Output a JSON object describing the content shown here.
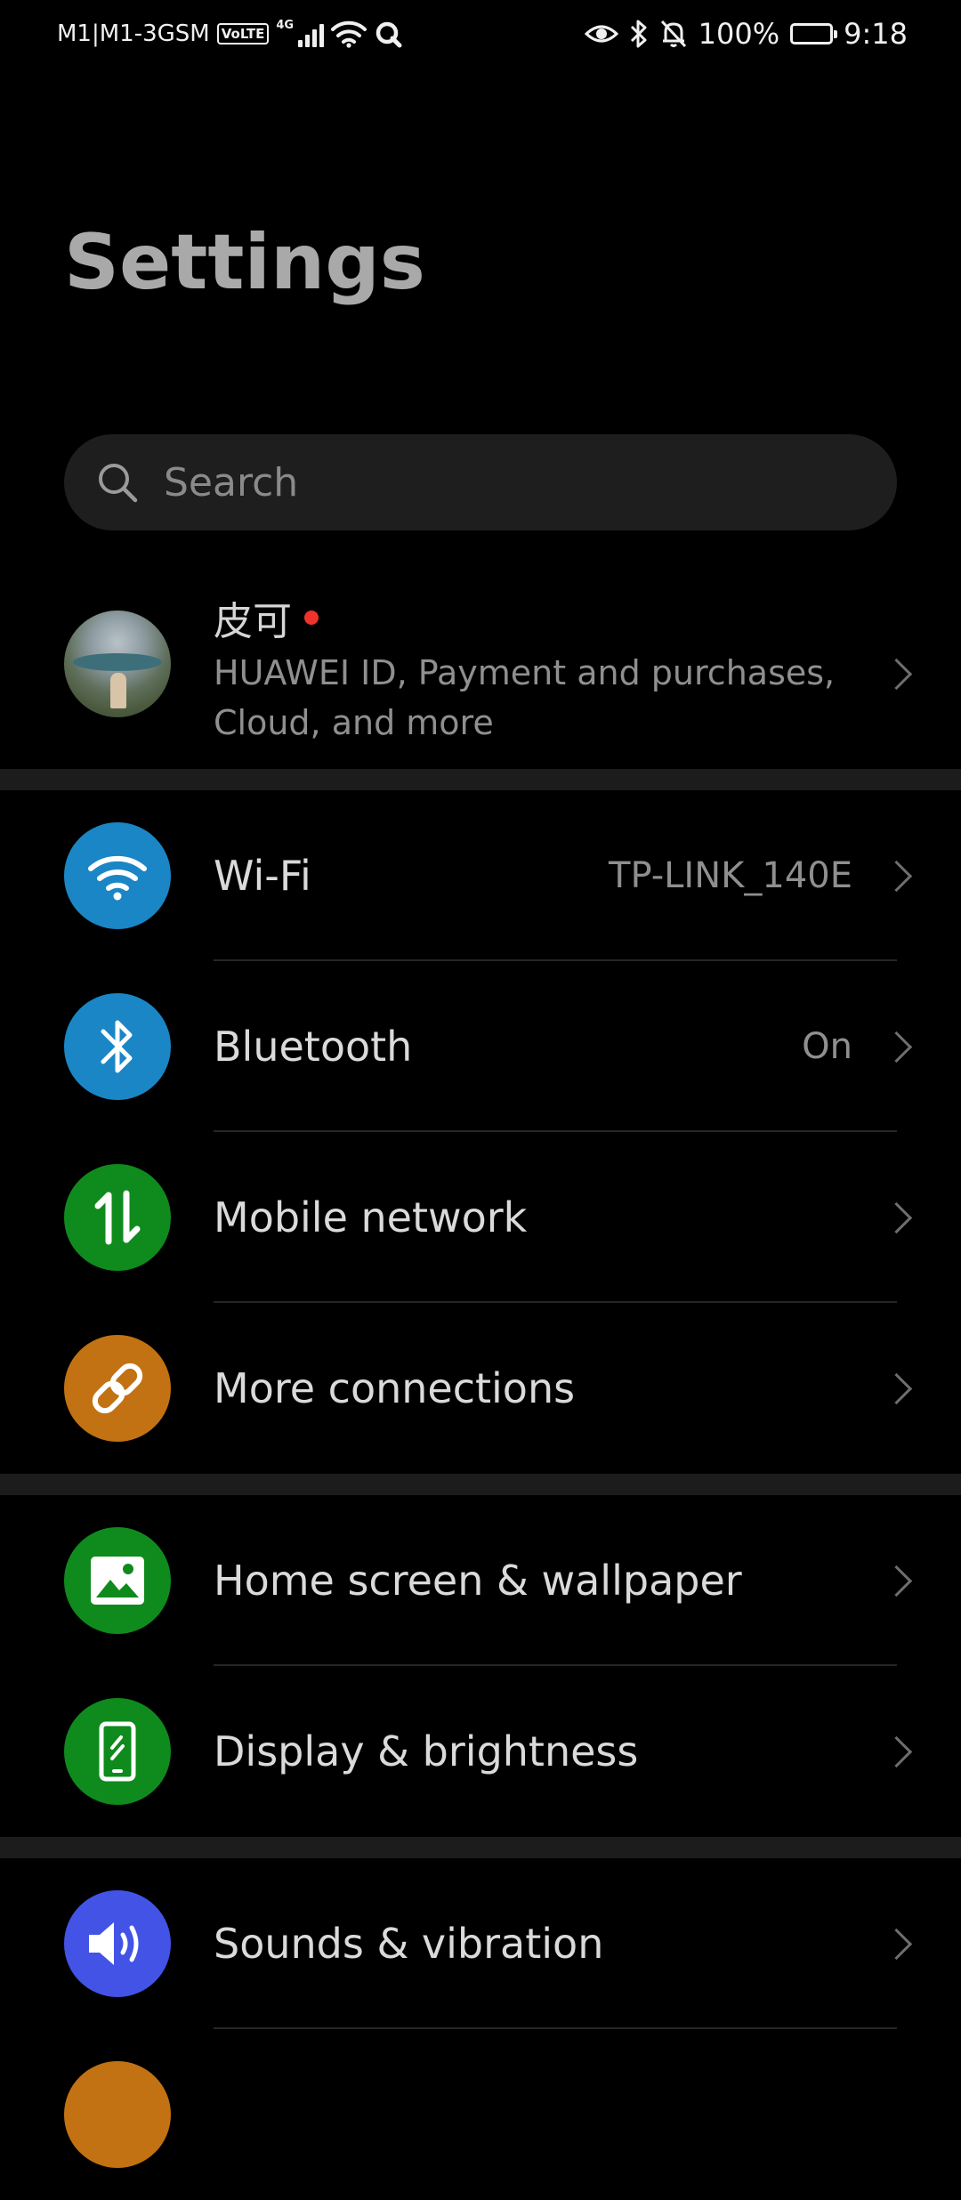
{
  "status_bar": {
    "carrier": "M1|M1-3GSM",
    "volte": "VoLTE",
    "network_type": "4G",
    "battery": "100%",
    "time": "9:18"
  },
  "page": {
    "title": "Settings"
  },
  "search": {
    "placeholder": "Search"
  },
  "account": {
    "name": "皮可",
    "subtitle": "HUAWEI ID, Payment and purchases, Cloud, and more"
  },
  "rows": [
    {
      "label": "Wi-Fi",
      "value": "TP-LINK_140E",
      "icon": "wifi-icon",
      "color": "#1a86c6"
    },
    {
      "label": "Bluetooth",
      "value": "On",
      "icon": "bluetooth-icon",
      "color": "#1a86c6"
    },
    {
      "label": "Mobile network",
      "value": "",
      "icon": "mobile-data-icon",
      "color": "#0f8a1d"
    },
    {
      "label": "More connections",
      "value": "",
      "icon": "link-icon",
      "color": "#c27212"
    },
    {
      "label": "Home screen & wallpaper",
      "value": "",
      "icon": "image-icon",
      "color": "#0f8a1d"
    },
    {
      "label": "Display & brightness",
      "value": "",
      "icon": "display-icon",
      "color": "#0f8a1d"
    },
    {
      "label": "Sounds & vibration",
      "value": "",
      "icon": "speaker-icon",
      "color": "#4353e6"
    }
  ],
  "partial_row": {
    "icon_color": "#c27212"
  }
}
